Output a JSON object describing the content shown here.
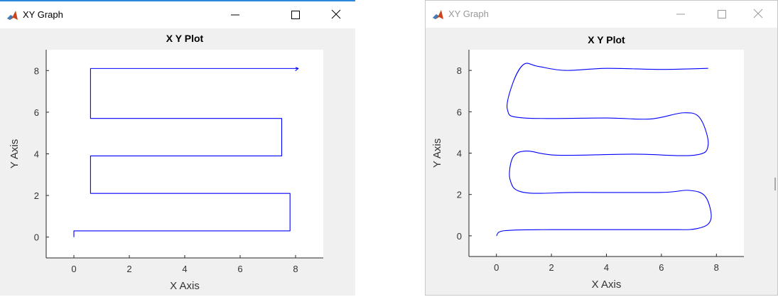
{
  "windows": [
    {
      "title": "XY Graph",
      "colors": {
        "window_bg": "#f0f0f0",
        "axes_bg": "#ffffff",
        "line": "#0000ff",
        "title_text": "#000000"
      },
      "icons": [
        "matlab-icon",
        "minimize-icon",
        "maximize-icon",
        "close-icon"
      ]
    },
    {
      "title": "XY Graph",
      "colors": {
        "window_bg": "#f0f0f0",
        "axes_bg": "#ffffff",
        "line": "#0000ff",
        "title_text": "#999999"
      },
      "icons": [
        "matlab-icon",
        "minimize-icon",
        "maximize-icon",
        "close-icon"
      ]
    }
  ],
  "chart_data": [
    {
      "type": "line",
      "title": "X Y Plot",
      "xlabel": "X Axis",
      "ylabel": "Y Axis",
      "xlim": [
        -1,
        9
      ],
      "ylim": [
        -1,
        9
      ],
      "xticks": [
        "0",
        "2",
        "4",
        "6",
        "8"
      ],
      "yticks": [
        "0",
        "2",
        "4",
        "6",
        "8"
      ],
      "grid": false,
      "series": [
        {
          "smooth": false,
          "points": [
            [
              0,
              0
            ],
            [
              0,
              0.3
            ],
            [
              7.8,
              0.3
            ],
            [
              7.8,
              2.1
            ],
            [
              0.6,
              2.1
            ],
            [
              0.6,
              3.9
            ],
            [
              7.5,
              3.9
            ],
            [
              7.5,
              5.7
            ],
            [
              0.6,
              5.7
            ],
            [
              0.6,
              8.1
            ],
            [
              8.1,
              8.1
            ],
            [
              8.0,
              8.0
            ],
            [
              8.1,
              8.1
            ],
            [
              8.0,
              8.15
            ]
          ]
        }
      ]
    },
    {
      "type": "line",
      "title": "X Y Plot",
      "xlabel": "X Axis",
      "ylabel": "Y Axis",
      "xlim": [
        -1,
        9
      ],
      "ylim": [
        -1,
        9
      ],
      "xticks": [
        "0",
        "2",
        "4",
        "6",
        "8"
      ],
      "yticks": [
        "0",
        "2",
        "4",
        "6",
        "8"
      ],
      "grid": false,
      "series": [
        {
          "smooth": true,
          "points": [
            [
              0,
              0
            ],
            [
              0.3,
              0.25
            ],
            [
              2,
              0.3
            ],
            [
              6,
              0.3
            ],
            [
              7.3,
              0.35
            ],
            [
              7.8,
              0.8
            ],
            [
              7.6,
              1.9
            ],
            [
              7,
              2.2
            ],
            [
              6,
              2.1
            ],
            [
              3,
              2.1
            ],
            [
              1,
              2.1
            ],
            [
              0.5,
              2.7
            ],
            [
              0.6,
              3.8
            ],
            [
              1.1,
              4.1
            ],
            [
              2.2,
              3.9
            ],
            [
              5,
              3.95
            ],
            [
              7.2,
              3.9
            ],
            [
              7.7,
              4.4
            ],
            [
              7.4,
              5.7
            ],
            [
              6.8,
              5.95
            ],
            [
              5.6,
              5.65
            ],
            [
              4,
              5.7
            ],
            [
              1,
              5.7
            ],
            [
              0.4,
              6.1
            ],
            [
              0.6,
              7.4
            ],
            [
              1.0,
              8.3
            ],
            [
              1.5,
              8.2
            ],
            [
              2.5,
              8.0
            ],
            [
              4,
              8.1
            ],
            [
              6,
              8.05
            ],
            [
              7.7,
              8.1
            ]
          ]
        }
      ]
    }
  ]
}
